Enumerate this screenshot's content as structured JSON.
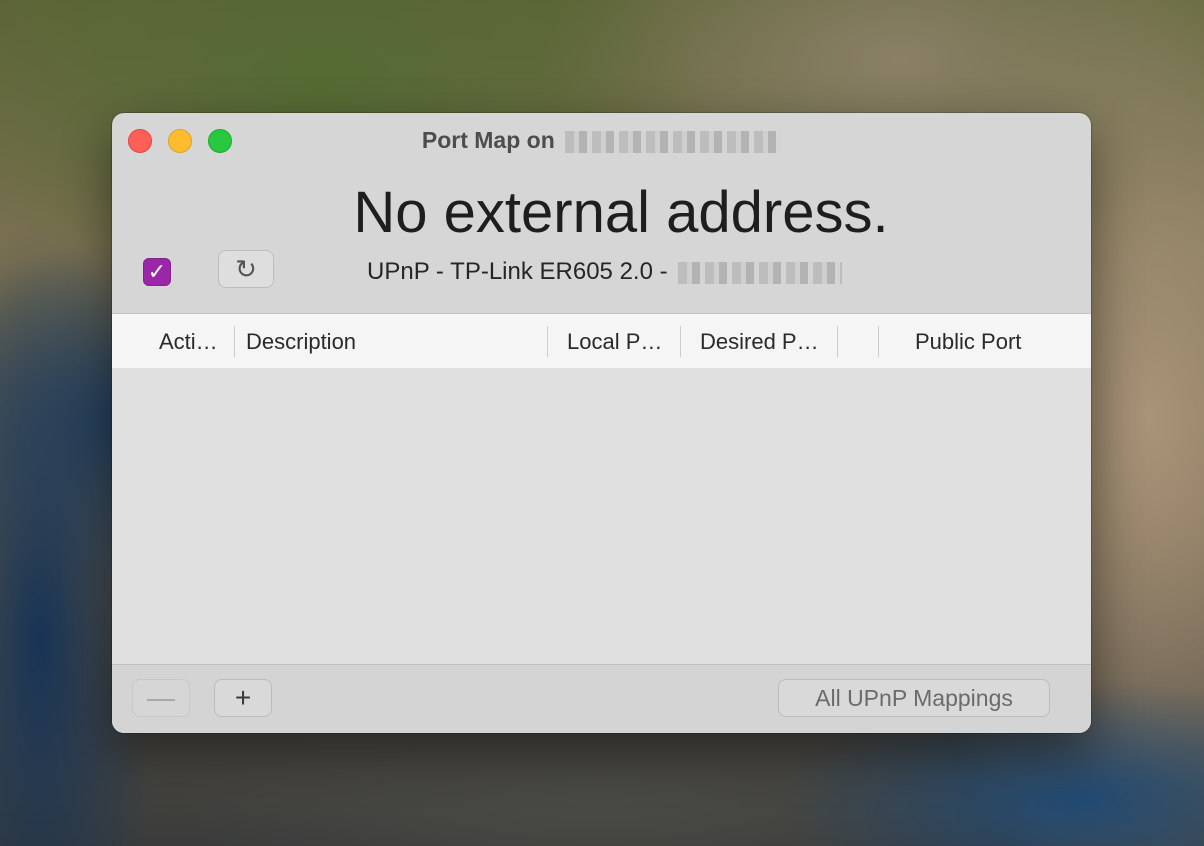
{
  "window": {
    "title": "Port Map on",
    "headline": "No external address.",
    "device_label": "UPnP - TP-Link ER605 2.0 -",
    "checkbox_glyph": "✓",
    "refresh_glyph": "↻"
  },
  "table": {
    "columns": {
      "active": "Acti…",
      "description": "Description",
      "local_port": "Local P…",
      "desired_port": "Desired P…",
      "public_port": "Public Port"
    }
  },
  "footer": {
    "minus_glyph": "—",
    "plus_glyph": "+",
    "all_mappings_label": "All UPnP Mappings"
  },
  "colors": {
    "accent_checkbox": "#9b27a8",
    "close": "#ff5f57",
    "minimize": "#febc2e",
    "maximize": "#28c840"
  }
}
